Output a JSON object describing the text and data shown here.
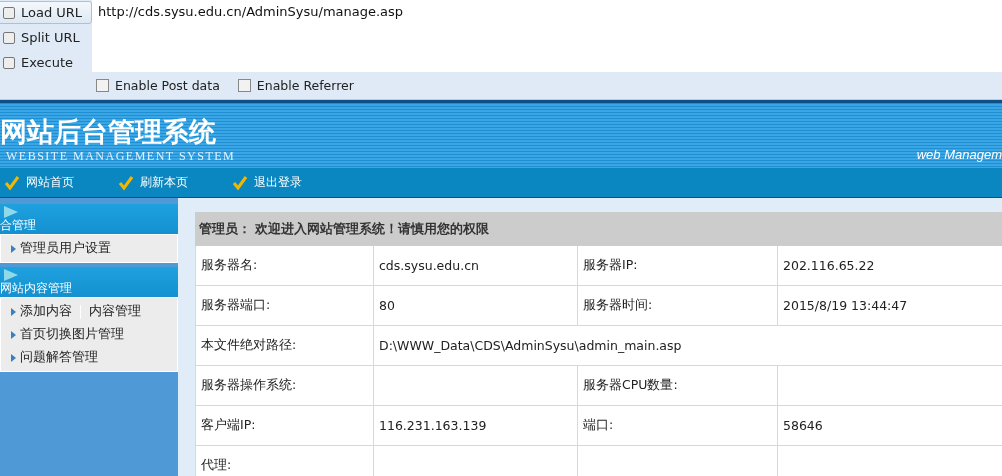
{
  "toolbar": {
    "actions": [
      {
        "label": "Load URL",
        "selected": true
      },
      {
        "label": "Split URL",
        "selected": false
      },
      {
        "label": "Execute",
        "selected": false
      }
    ],
    "url": "http://cds.sysu.edu.cn/AdminSysu/manage.asp",
    "options": [
      {
        "label": "Enable Post data",
        "checked": false
      },
      {
        "label": "Enable Referrer",
        "checked": false
      }
    ]
  },
  "banner": {
    "title": "网站后台管理系统",
    "subtitle": "WEBSITE MANAGEMENT SYSTEM",
    "tagline": "web Managem"
  },
  "nav": [
    "网站首页",
    "刷新本页",
    "退出登录"
  ],
  "sidebar": [
    {
      "title": "合管理",
      "items": [
        [
          "管理员用户设置"
        ]
      ]
    },
    {
      "title": "网站内容管理",
      "items": [
        [
          "添加内容",
          "内容管理"
        ],
        [
          "首页切换图片管理"
        ],
        [
          "问题解答管理"
        ]
      ]
    }
  ],
  "info": {
    "heading": "管理员： 欢迎进入网站管理系统！请慎用您的权限",
    "rows": [
      [
        "服务器名:",
        "cds.sysu.edu.cn",
        "服务器IP:",
        "202.116.65.22"
      ],
      [
        "服务器端口:",
        "80",
        "服务器时间:",
        "2015/8/19 13:44:47"
      ],
      [
        "本文件绝对路径:",
        "D:\\WWW_Data\\CDS\\AdminSysu\\admin_main.asp"
      ],
      [
        "服务器操作系统:",
        "",
        "服务器CPU数量:",
        ""
      ],
      [
        "客户端IP:",
        "116.231.163.139",
        "端口:",
        "58646"
      ],
      [
        "代理:",
        "",
        "",
        ""
      ]
    ]
  }
}
